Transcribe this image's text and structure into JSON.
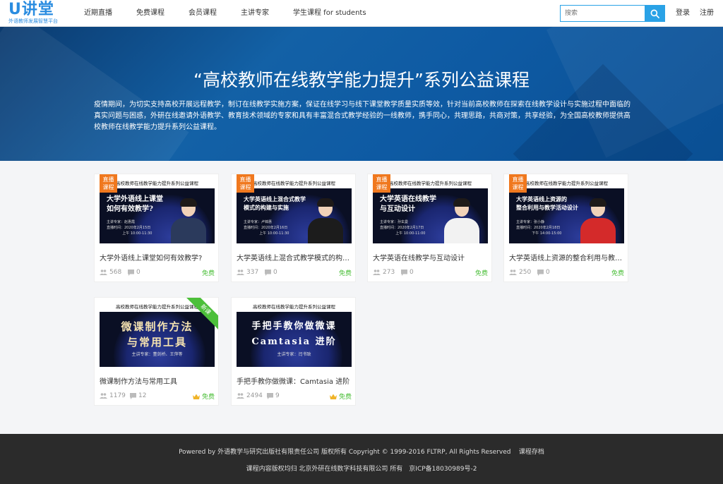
{
  "logo": {
    "main": "U讲堂",
    "sub": "外语教师发展智慧平台"
  },
  "nav": {
    "items": [
      "近期直播",
      "免费课程",
      "会员课程",
      "主讲专家",
      "学生课程 for students"
    ]
  },
  "search": {
    "placeholder": "搜索"
  },
  "auth": {
    "login": "登录",
    "register": "注册"
  },
  "hero": {
    "title": "“高校教师在线教学能力提升”系列公益课程",
    "description": "疫情期间，为切实支持高校开展远程教学，制订在线教学实施方案，保证在线学习与线下课堂教学质量实质等效，针对当前高校教师在探索在线教学设计与实施过程中面临的真实问题与困惑，外研在线邀请外语教学、教育技术领域的专家和具有丰富混合式教学经验的一线教师，携手同心，共理思路，共商对策，共享经验，为全国高校教师提供高校教师在线教学能力提升系列公益课程。"
  },
  "courses": [
    {
      "title": "大学外语线上课堂如何有效教学?",
      "thumb_banner": "高校教师在线教学能力提升系列公益课程",
      "thumb_title": "大学外语线上课堂\n如何有效教学?",
      "thumb_meta": "主讲专家：赵惠霞\n直播时间：2020年2月15日\n              上午 10:00-11:30",
      "badge": "直播\n课程",
      "students": "568",
      "comments": "0",
      "price": "免费"
    },
    {
      "title": "大学英语线上混合式教学模式的构建与实施",
      "thumb_banner": "高校教师在线教学能力提升系列公益课程",
      "thumb_title": "大学英语线上混合式教学\n模式的构建与实施",
      "thumb_meta": "主讲专家：卢锦惠\n直播时间：2020年2月16日\n              上午 10:00-11:30",
      "badge": "直播\n课程",
      "students": "337",
      "comments": "0",
      "price": "免费"
    },
    {
      "title": "大学英语在线教学与互动设计",
      "thumb_banner": "高校教师在线教学能力提升系列公益课程",
      "thumb_title": "大学英语在线教学\n与互动设计",
      "thumb_meta": "主讲专家：孙玄曼\n直播时间：2020年2月17日\n              上午 10:00-11:00",
      "badge": "直播\n课程",
      "students": "273",
      "comments": "0",
      "price": "免费"
    },
    {
      "title": "大学英语线上资源的整合利用与教学活动设计",
      "thumb_banner": "高校教师在线教学能力提升系列公益课程",
      "thumb_title": "大学英语线上资源的\n整合利用与教学活动设计",
      "thumb_meta": "主讲专家：张小静\n直播时间：2020年2月18日\n              下午 14:00-15:00",
      "badge": "直播\n课程",
      "students": "250",
      "comments": "0",
      "price": "免费"
    },
    {
      "title": "微课制作方法与常用工具",
      "thumb_banner": "高校教师在线教学能力提升系列公益课程",
      "thumb_title": "微课制作方法\n与常用工具",
      "thumb_meta": "主讲专家：董剑桥、王萍等",
      "ribbon": "新课",
      "students": "1179",
      "comments": "12",
      "price": "免费"
    },
    {
      "title": "手把手教你做微课：Camtasia 进阶",
      "thumb_banner": "高校教师在线教学能力提升系列公益课程",
      "thumb_title": "手把手教你做微课\nCamtasia 进阶",
      "thumb_meta": "主讲专家：闫书致",
      "students": "2494",
      "comments": "9",
      "price": "免费"
    }
  ],
  "footer": {
    "line1": "Powered by 外语教学与研究出版社有限责任公司 版权所有 Copyright © 1999-2016 FLTRP, All Rights Reserved",
    "archive": "课程存档",
    "line2": "课程内容版权均归 北京外研在线数字科技有限公司 所有　京ICP备18030989号-2"
  },
  "colors": {
    "accent": "#2aa2e6",
    "free_green": "#4cbf3a",
    "badge_orange": "#f0781e",
    "footer_bg": "#2b2b2b"
  },
  "icons": {
    "search": "search-icon",
    "students": "people-icon",
    "comments": "comment-icon",
    "vip": "crown-icon"
  }
}
